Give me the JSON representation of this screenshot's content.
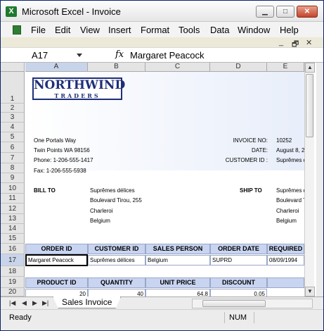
{
  "window": {
    "title": "Microsoft Excel - Invoice",
    "buttons": {
      "minimize": "▁",
      "maximize": "□",
      "close": "✕"
    }
  },
  "menu": [
    "File",
    "Edit",
    "View",
    "Insert",
    "Format",
    "Tools",
    "Data",
    "Window",
    "Help"
  ],
  "doc_controls": {
    "minimize": "_",
    "restore": "🗗",
    "close": "✕"
  },
  "formula_bar": {
    "name_box": "A17",
    "fx": "fx",
    "value": "Margaret Peacock"
  },
  "columns": [
    "A",
    "B",
    "C",
    "D",
    "E"
  ],
  "rows": [
    "1",
    "2",
    "3",
    "4",
    "5",
    "6",
    "7",
    "8",
    "9",
    "10",
    "11",
    "12",
    "13",
    "14",
    "15",
    "16",
    "17",
    "18",
    "19",
    "20"
  ],
  "logo": {
    "top": "NORTHWIND",
    "bottom": "TRADERS"
  },
  "company": {
    "address": "One Portals Way",
    "city": "Twin Points WA 98156",
    "phone": "Phone: 1-206-555-1417",
    "fax": "Fax: 1-206-555-5938"
  },
  "invoice": {
    "no_label": "INVOICE NO:",
    "no_value": "10252",
    "date_label": "DATE:",
    "date_value": "August 8, 2",
    "customer_label": "CUSTOMER ID :",
    "customer_value": "Suprêmes d"
  },
  "bill_to": {
    "label": "BILL TO",
    "lines": [
      "Suprêmes délices",
      "Boulevard Tirou, 255",
      "Charleroi",
      "Belgium"
    ]
  },
  "ship_to": {
    "label": "SHIP TO",
    "lines": [
      "Suprêmes d",
      "Boulevard T",
      "Charleroi",
      "Belgium"
    ]
  },
  "order_table": {
    "headers": [
      "ORDER ID",
      "CUSTOMER ID",
      "SALES PERSON",
      "ORDER DATE",
      "REQUIRED"
    ],
    "row": [
      "Margaret Peacock",
      "Suprêmes délices",
      "Belgium",
      "SUPRD",
      "08/09/1994"
    ]
  },
  "product_table": {
    "headers": [
      "PRODUCT ID",
      "QUANTITY",
      "UNIT PRICE",
      "DISCOUNT"
    ],
    "row": [
      "20",
      "40",
      "64.8",
      "0.05"
    ]
  },
  "tabs": {
    "nav": [
      "|◀",
      "◀",
      "▶",
      "▶|"
    ],
    "active": "Sales Invoice"
  },
  "status": {
    "ready": "Ready",
    "num": "NUM"
  }
}
